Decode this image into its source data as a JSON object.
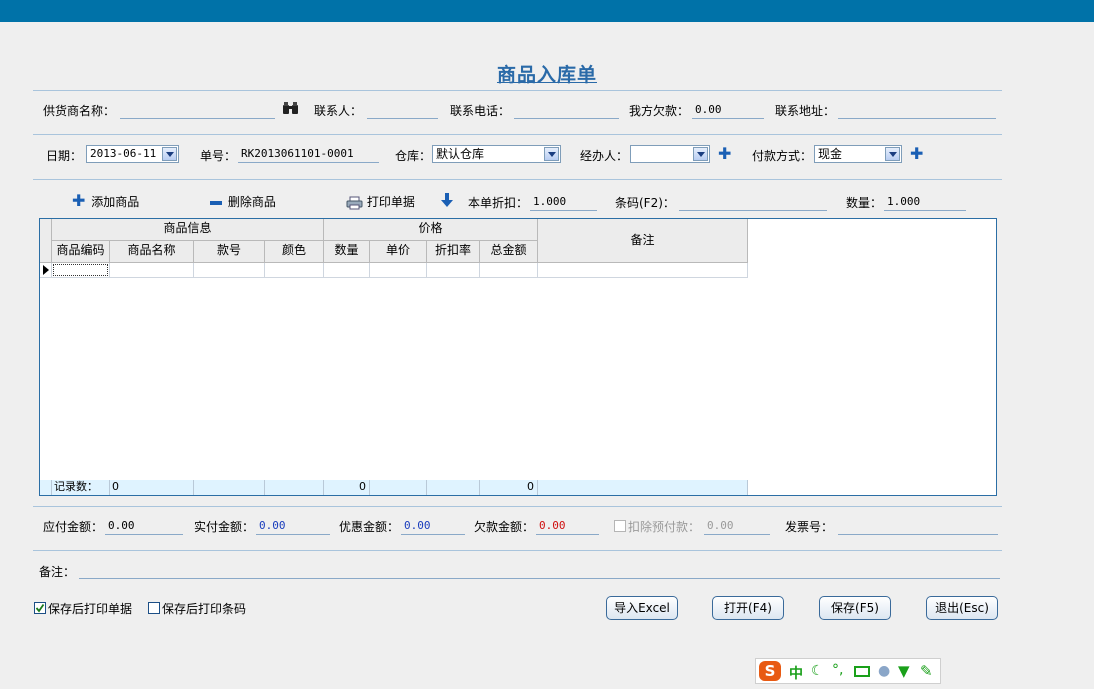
{
  "title": "商品入库单",
  "row1": {
    "supplier_label": "供货商名称：",
    "supplier_value": "",
    "contact_label": "联系人：",
    "contact_value": "",
    "phone_label": "联系电话：",
    "phone_value": "",
    "debt_label": "我方欠款：",
    "debt_value": "0.00",
    "address_label": "联系地址：",
    "address_value": ""
  },
  "row2": {
    "date_label": "日期：",
    "date_value": "2013-06-11",
    "order_label": "单号：",
    "order_value": "RK2013061101-0001",
    "warehouse_label": "仓库：",
    "warehouse_value": "默认仓库",
    "handler_label": "经办人：",
    "handler_value": "",
    "payment_label": "付款方式：",
    "payment_value": "现金"
  },
  "toolbar": {
    "add_label": "添加商品",
    "delete_label": "删除商品",
    "print_label": "打印单据",
    "discount_label": "本单折扣：",
    "discount_value": "1.000",
    "barcode_label": "条码(F2)：",
    "barcode_value": "",
    "qty_label": "数量：",
    "qty_value": "1.000"
  },
  "grid": {
    "group_product": "商品信息",
    "group_price": "价格",
    "remark_header": "备注",
    "columns": [
      "商品编码",
      "商品名称",
      "款号",
      "颜色",
      "数量",
      "单价",
      "折扣率",
      "总金额"
    ],
    "footer_label": "记录数：",
    "footer_count": "0",
    "footer_qty": "0",
    "footer_total": "0"
  },
  "totals": {
    "payable_label": "应付金额：",
    "payable_value": "0.00",
    "paid_label": "实付金额：",
    "paid_value": "0.00",
    "discount_amount_label": "优惠金额：",
    "discount_amount_value": "0.00",
    "owed_label": "欠款金额：",
    "owed_value": "0.00",
    "prepay_label": "扣除预付款：",
    "prepay_value": "0.00",
    "invoice_label": "发票号：",
    "invoice_value": ""
  },
  "remark": {
    "label": "备注：",
    "value": ""
  },
  "options": {
    "print_doc_label": "保存后打印单据",
    "print_barcode_label": "保存后打印条码"
  },
  "buttons": {
    "import": "导入Excel",
    "open": "打开(F4)",
    "save": "保存(F5)",
    "exit": "退出(Esc)"
  },
  "ime": {
    "logo": "S",
    "mode": "中"
  },
  "colors": {
    "topbar": "#0072a8",
    "title": "#2a6aa8",
    "paid_value": "#1a3dbd",
    "owed_value": "#d01010",
    "disabled": "#9a9a9a"
  }
}
